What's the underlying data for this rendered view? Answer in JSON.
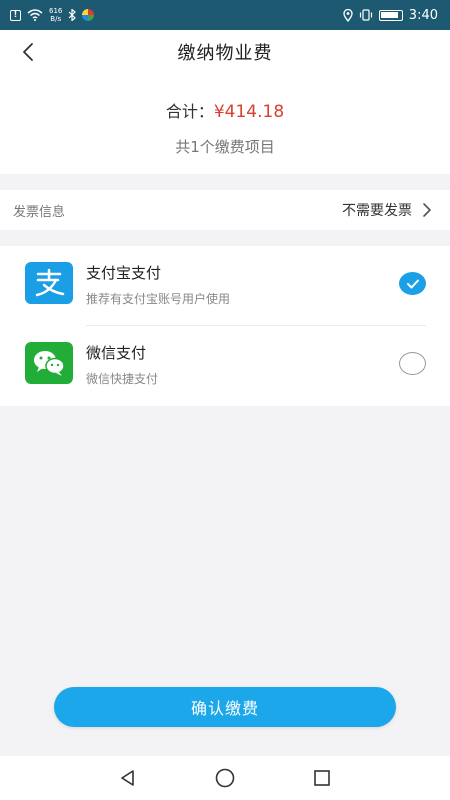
{
  "status_bar": {
    "net_speed_value": "616",
    "net_speed_unit": "B/s",
    "time": "3:40",
    "icons": [
      "alert-icon",
      "wifi-icon",
      "bluetooth-icon",
      "app-icon",
      "location-icon",
      "vibrate-icon",
      "battery-icon"
    ]
  },
  "header": {
    "title": "缴纳物业费",
    "back_icon": "chevron-left-icon"
  },
  "summary": {
    "total_label": "合计：",
    "total_amount": "¥414.18",
    "item_count": "共1个缴费项目"
  },
  "invoice": {
    "label": "发票信息",
    "value": "不需要发票",
    "icon": "chevron-right-icon"
  },
  "payment_methods": [
    {
      "name": "支付宝支付",
      "description": "推荐有支付宝账号用户使用",
      "icon": "alipay-icon",
      "selected": true
    },
    {
      "name": "微信支付",
      "description": "微信快捷支付",
      "icon": "wechat-icon",
      "selected": false
    }
  ],
  "confirm_button": {
    "label": "确认缴费"
  },
  "system_nav": {
    "icons": [
      "back-triangle-icon",
      "home-circle-icon",
      "recents-square-icon"
    ]
  },
  "colors": {
    "status_bar": "#1d5a72",
    "accent": "#1ba7ea",
    "amount": "#d8412f",
    "alipay": "#1a9ee6",
    "wechat": "#22ad38"
  }
}
